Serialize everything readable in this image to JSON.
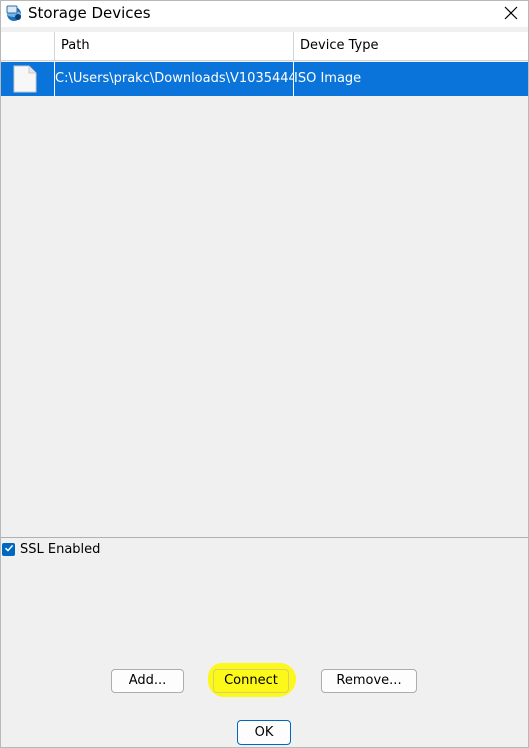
{
  "window": {
    "title": "Storage Devices"
  },
  "table": {
    "columns": [
      "",
      "Path",
      "Device Type"
    ],
    "rows": [
      {
        "icon": "file-icon",
        "path": "C:\\Users\\prakc\\Downloads\\V1035444-...",
        "device_type": "ISO Image",
        "selected": true
      }
    ]
  },
  "ssl": {
    "label": "SSL Enabled",
    "checked": true
  },
  "buttons": {
    "add": "Add...",
    "connect": "Connect",
    "remove": "Remove...",
    "ok": "OK"
  },
  "colors": {
    "selection": "#0a74da",
    "highlight": "#fcf81a",
    "checkbox": "#0067c0"
  },
  "icons": {
    "app": "storage-devices-icon",
    "close": "close-icon",
    "row": "file-icon",
    "check": "checkmark-icon"
  }
}
